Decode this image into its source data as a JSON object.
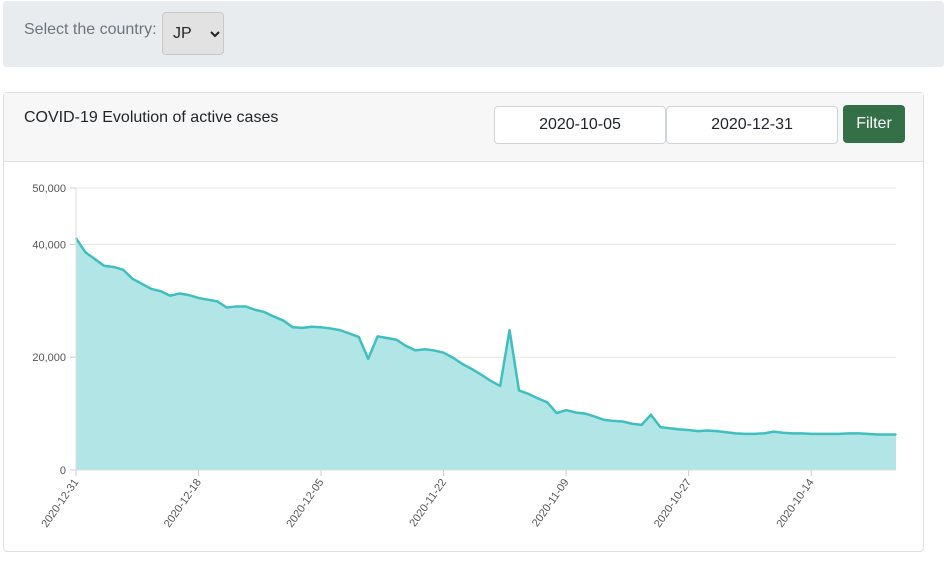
{
  "filter_bar": {
    "country_label": "Select the country:",
    "country_value": "JP"
  },
  "card": {
    "title": "COVID-19 Evolution of active cases",
    "date_from": "2020-10-05",
    "date_to": "2020-12-31",
    "filter_label": "Filter"
  },
  "colors": {
    "line": "#3fbfbf",
    "fill": "#b2e5e5",
    "filter_button": "#346f48"
  },
  "chart_data": {
    "type": "area",
    "x_order": "descending (newest date on the left)",
    "ylim": [
      0,
      50000
    ],
    "y_ticks": [
      0,
      20000,
      40000,
      50000
    ],
    "y_tick_labels": [
      "0",
      "20,000",
      "40,000",
      "50,000"
    ],
    "x_tick_labels": [
      "2020-12-31",
      "2020-12-18",
      "2020-12-05",
      "2020-11-22",
      "2020-11-09",
      "2020-10-27",
      "2020-10-14"
    ],
    "grid": true,
    "legend": "none",
    "series": [
      {
        "x": [
          "2020-12-31",
          "2020-12-30",
          "2020-12-29",
          "2020-12-28",
          "2020-12-27",
          "2020-12-26",
          "2020-12-25",
          "2020-12-24",
          "2020-12-23",
          "2020-12-22",
          "2020-12-21",
          "2020-12-20",
          "2020-12-19",
          "2020-12-18",
          "2020-12-17",
          "2020-12-16",
          "2020-12-15",
          "2020-12-14",
          "2020-12-13",
          "2020-12-12",
          "2020-12-11",
          "2020-12-10",
          "2020-12-09",
          "2020-12-08",
          "2020-12-07",
          "2020-12-06",
          "2020-12-05",
          "2020-12-04",
          "2020-12-03",
          "2020-12-02",
          "2020-12-01",
          "2020-11-30",
          "2020-11-29",
          "2020-11-28",
          "2020-11-27",
          "2020-11-26",
          "2020-11-25",
          "2020-11-24",
          "2020-11-23",
          "2020-11-22",
          "2020-11-21",
          "2020-11-20",
          "2020-11-19",
          "2020-11-18",
          "2020-11-17",
          "2020-11-16",
          "2020-11-15",
          "2020-11-14",
          "2020-11-13",
          "2020-11-12",
          "2020-11-11",
          "2020-11-10",
          "2020-11-09",
          "2020-11-08",
          "2020-11-07",
          "2020-11-06",
          "2020-11-05",
          "2020-11-04",
          "2020-11-03",
          "2020-11-02",
          "2020-11-01",
          "2020-10-31",
          "2020-10-30",
          "2020-10-29",
          "2020-10-28",
          "2020-10-27",
          "2020-10-26",
          "2020-10-25",
          "2020-10-24",
          "2020-10-23",
          "2020-10-22",
          "2020-10-21",
          "2020-10-20",
          "2020-10-19",
          "2020-10-18",
          "2020-10-17",
          "2020-10-16",
          "2020-10-15",
          "2020-10-14",
          "2020-10-13",
          "2020-10-12",
          "2020-10-11",
          "2020-10-10",
          "2020-10-09",
          "2020-10-08",
          "2020-10-07",
          "2020-10-06",
          "2020-10-05"
        ],
        "values": [
          41100,
          38600,
          37400,
          36200,
          36000,
          35500,
          33900,
          33000,
          32100,
          31700,
          30900,
          31300,
          31000,
          30500,
          30200,
          29900,
          28800,
          29000,
          29000,
          28400,
          28000,
          27200,
          26500,
          25300,
          25200,
          25400,
          25300,
          25100,
          24800,
          24200,
          23600,
          19700,
          23700,
          23400,
          23100,
          22000,
          21200,
          21400,
          21200,
          20800,
          19900,
          18800,
          17900,
          16900,
          15800,
          14900,
          24800,
          14100,
          13500,
          12700,
          12000,
          10100,
          10600,
          10200,
          10000,
          9500,
          8900,
          8700,
          8600,
          8200,
          8000,
          9800,
          7600,
          7400,
          7200,
          7100,
          6900,
          7000,
          6900,
          6700,
          6500,
          6400,
          6400,
          6500,
          6800,
          6600,
          6500,
          6500,
          6400,
          6400,
          6400,
          6400,
          6500,
          6500,
          6400,
          6300,
          6300,
          6300
        ]
      }
    ]
  }
}
